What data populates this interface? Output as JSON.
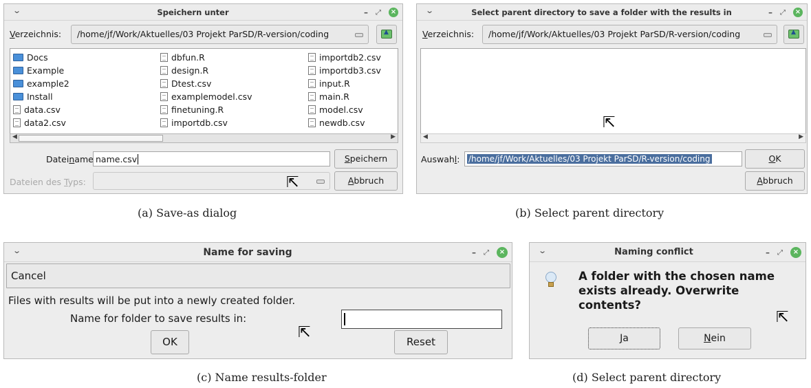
{
  "dialog_a": {
    "title": "Speichern unter",
    "dir_label_pre": "V",
    "dir_label_rest": "erzeichnis:",
    "dir_path": "/home/jf/Work/Aktuelles/03 Projekt ParSD/R-version/coding",
    "files_col1": [
      {
        "name": "Docs",
        "type": "folder"
      },
      {
        "name": "Example",
        "type": "folder"
      },
      {
        "name": "example2",
        "type": "folder"
      },
      {
        "name": "Install",
        "type": "folder"
      },
      {
        "name": "data.csv",
        "type": "file"
      },
      {
        "name": "data2.csv",
        "type": "file"
      }
    ],
    "files_col2": [
      {
        "name": "dbfun.R",
        "type": "file"
      },
      {
        "name": "design.R",
        "type": "file"
      },
      {
        "name": "Dtest.csv",
        "type": "file"
      },
      {
        "name": "examplemodel.csv",
        "type": "file"
      },
      {
        "name": "finetuning.R",
        "type": "file"
      },
      {
        "name": "importdb.csv",
        "type": "file"
      }
    ],
    "files_col3": [
      {
        "name": "importdb2.csv",
        "type": "file"
      },
      {
        "name": "importdb3.csv",
        "type": "file"
      },
      {
        "name": "input.R",
        "type": "file"
      },
      {
        "name": "main.R",
        "type": "file"
      },
      {
        "name": "model.csv",
        "type": "file"
      },
      {
        "name": "newdb.csv",
        "type": "file"
      }
    ],
    "filename_label_a": "Datei",
    "filename_label_u": "n",
    "filename_label_b": "ame:",
    "filename_value": "name.csv",
    "save_pre": "",
    "save_u": "S",
    "save_rest": "peichern",
    "filetype_label_a": "Dateien des ",
    "filetype_label_u": "T",
    "filetype_label_b": "yps:",
    "cancel_u": "A",
    "cancel_rest": "bbruch",
    "caption": "(a)  Save-as dialog"
  },
  "dialog_b": {
    "title": "Select parent directory to save a folder with the results in",
    "dir_label_pre": "V",
    "dir_label_rest": "erzeichnis:",
    "dir_path": "/home/jf/Work/Aktuelles/03 Projekt ParSD/R-version/coding",
    "selection_label_a": "Auswah",
    "selection_label_u": "l",
    "selection_label_b": ":",
    "selection_value": "/home/jf/Work/Aktuelles/03 Projekt ParSD/R-version/coding",
    "ok_u": "O",
    "ok_rest": "K",
    "cancel_u": "A",
    "cancel_rest": "bbruch",
    "caption": "(b)  Select parent directory"
  },
  "dialog_c": {
    "title": "Name for saving",
    "menu_cancel": "Cancel",
    "info_text": "Files with results will be put into a newly created folder.",
    "prompt": "Name for folder to save results in:",
    "ok": "OK",
    "reset": "Reset",
    "caption": "(c)  Name results-folder"
  },
  "dialog_d": {
    "title": "Naming conflict",
    "message_line1": "A folder with the chosen name",
    "message_line2": "exists already. Overwrite",
    "message_line3": "contents?",
    "yes_u": "J",
    "yes_rest": "a",
    "no_u": "N",
    "no_rest": "ein",
    "caption": "(d)  Select parent directory"
  },
  "icons": {
    "titlebar_menu": "chevron-down-icon",
    "minimize": "minimize-icon",
    "maximize": "maximize-icon",
    "close": "close-icon",
    "folder_up": "folder-up-icon",
    "info": "lightbulb-icon",
    "cursor": "mouse-pointer-icon"
  },
  "colors": {
    "close_button": "#5bb55e",
    "folder": "#4a90d9",
    "selection": "#4a6e9e",
    "window_bg": "#ededed"
  }
}
